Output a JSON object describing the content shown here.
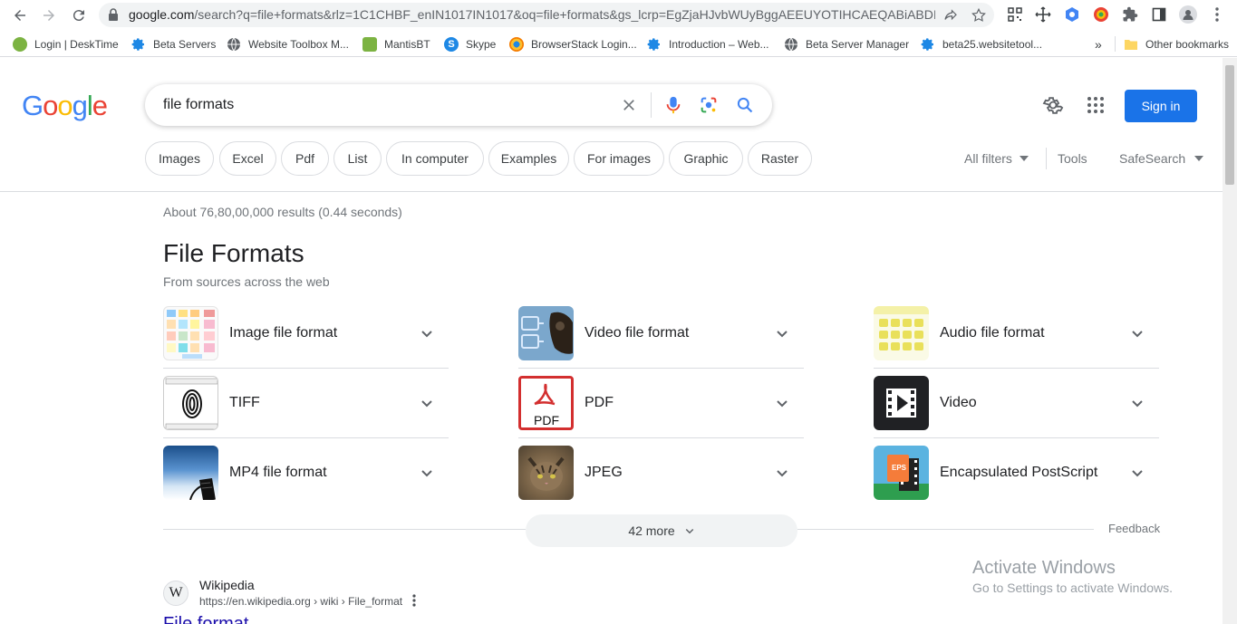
{
  "browser": {
    "url_host": "google.com",
    "url_path": "/search?q=file+formats&rlz=1C1CHBF_enIN1017IN1017&oq=file+formats&gs_lcrp=EgZjaHJvbWUyBggAEEUYOTIHCAEQABiABDI...",
    "bookmarks": [
      {
        "label": "Login | DeskTime",
        "icon": "desktime-icon",
        "color": "#7cb342"
      },
      {
        "label": "Beta Servers",
        "icon": "gear-icon",
        "color": "#1e88e5"
      },
      {
        "label": "Website Toolbox M...",
        "icon": "globe-icon",
        "color": "#5f6368"
      },
      {
        "label": "MantisBT",
        "icon": "mantis-icon",
        "color": "#7cb342"
      },
      {
        "label": "Skype",
        "icon": "skype-icon",
        "color": "#1e88e5"
      },
      {
        "label": "BrowserStack Login...",
        "icon": "browserstack-icon",
        "color": "#f57c00"
      },
      {
        "label": "Introduction – Web...",
        "icon": "gear-icon",
        "color": "#1e88e5"
      },
      {
        "label": "Beta Server Manager",
        "icon": "globe-icon",
        "color": "#5f6368"
      },
      {
        "label": "beta25.websitetool...",
        "icon": "gear-icon",
        "color": "#1e88e5"
      }
    ],
    "overflow_label": "»",
    "other_bookmarks": "Other bookmarks"
  },
  "search": {
    "query": "file formats",
    "sign_in": "Sign in",
    "chips": [
      "Images",
      "Excel",
      "Pdf",
      "List",
      "In computer",
      "Examples",
      "For images",
      "Graphic",
      "Raster"
    ],
    "all_filters": "All filters",
    "tools": "Tools",
    "safesearch": "SafeSearch"
  },
  "results": {
    "stats": "About 76,80,00,000 results (0.44 seconds)",
    "section_title": "File Formats",
    "section_subtitle": "From sources across the web",
    "items": [
      {
        "label": "Image file format",
        "thumb": "image-file-format-thumb"
      },
      {
        "label": "Video file format",
        "thumb": "video-file-format-thumb"
      },
      {
        "label": "Audio file format",
        "thumb": "audio-file-format-thumb"
      },
      {
        "label": "TIFF",
        "thumb": "tiff-thumb"
      },
      {
        "label": "PDF",
        "thumb": "pdf-thumb",
        "thumb_text": "PDF"
      },
      {
        "label": "Video",
        "thumb": "video-thumb"
      },
      {
        "label": "MP4 file format",
        "thumb": "mp4-thumb"
      },
      {
        "label": "JPEG",
        "thumb": "jpeg-thumb"
      },
      {
        "label": "Encapsulated PostScript",
        "thumb": "eps-thumb",
        "thumb_text": "EPS"
      }
    ],
    "more_button": "42 more",
    "feedback": "Feedback",
    "wiki": {
      "icon_letter": "W",
      "site_name": "Wikipedia",
      "url": "https://en.wikipedia.org › wiki › File_format",
      "title": "File format"
    }
  },
  "overlay": {
    "line1": "Activate Windows",
    "line2": "Go to Settings to activate Windows."
  },
  "colors": {
    "google_blue": "#4285f4",
    "google_red": "#ea4335",
    "google_yellow": "#fbbc05",
    "google_green": "#34a853",
    "link_blue": "#1a0dab",
    "signin_blue": "#1a73e8"
  }
}
